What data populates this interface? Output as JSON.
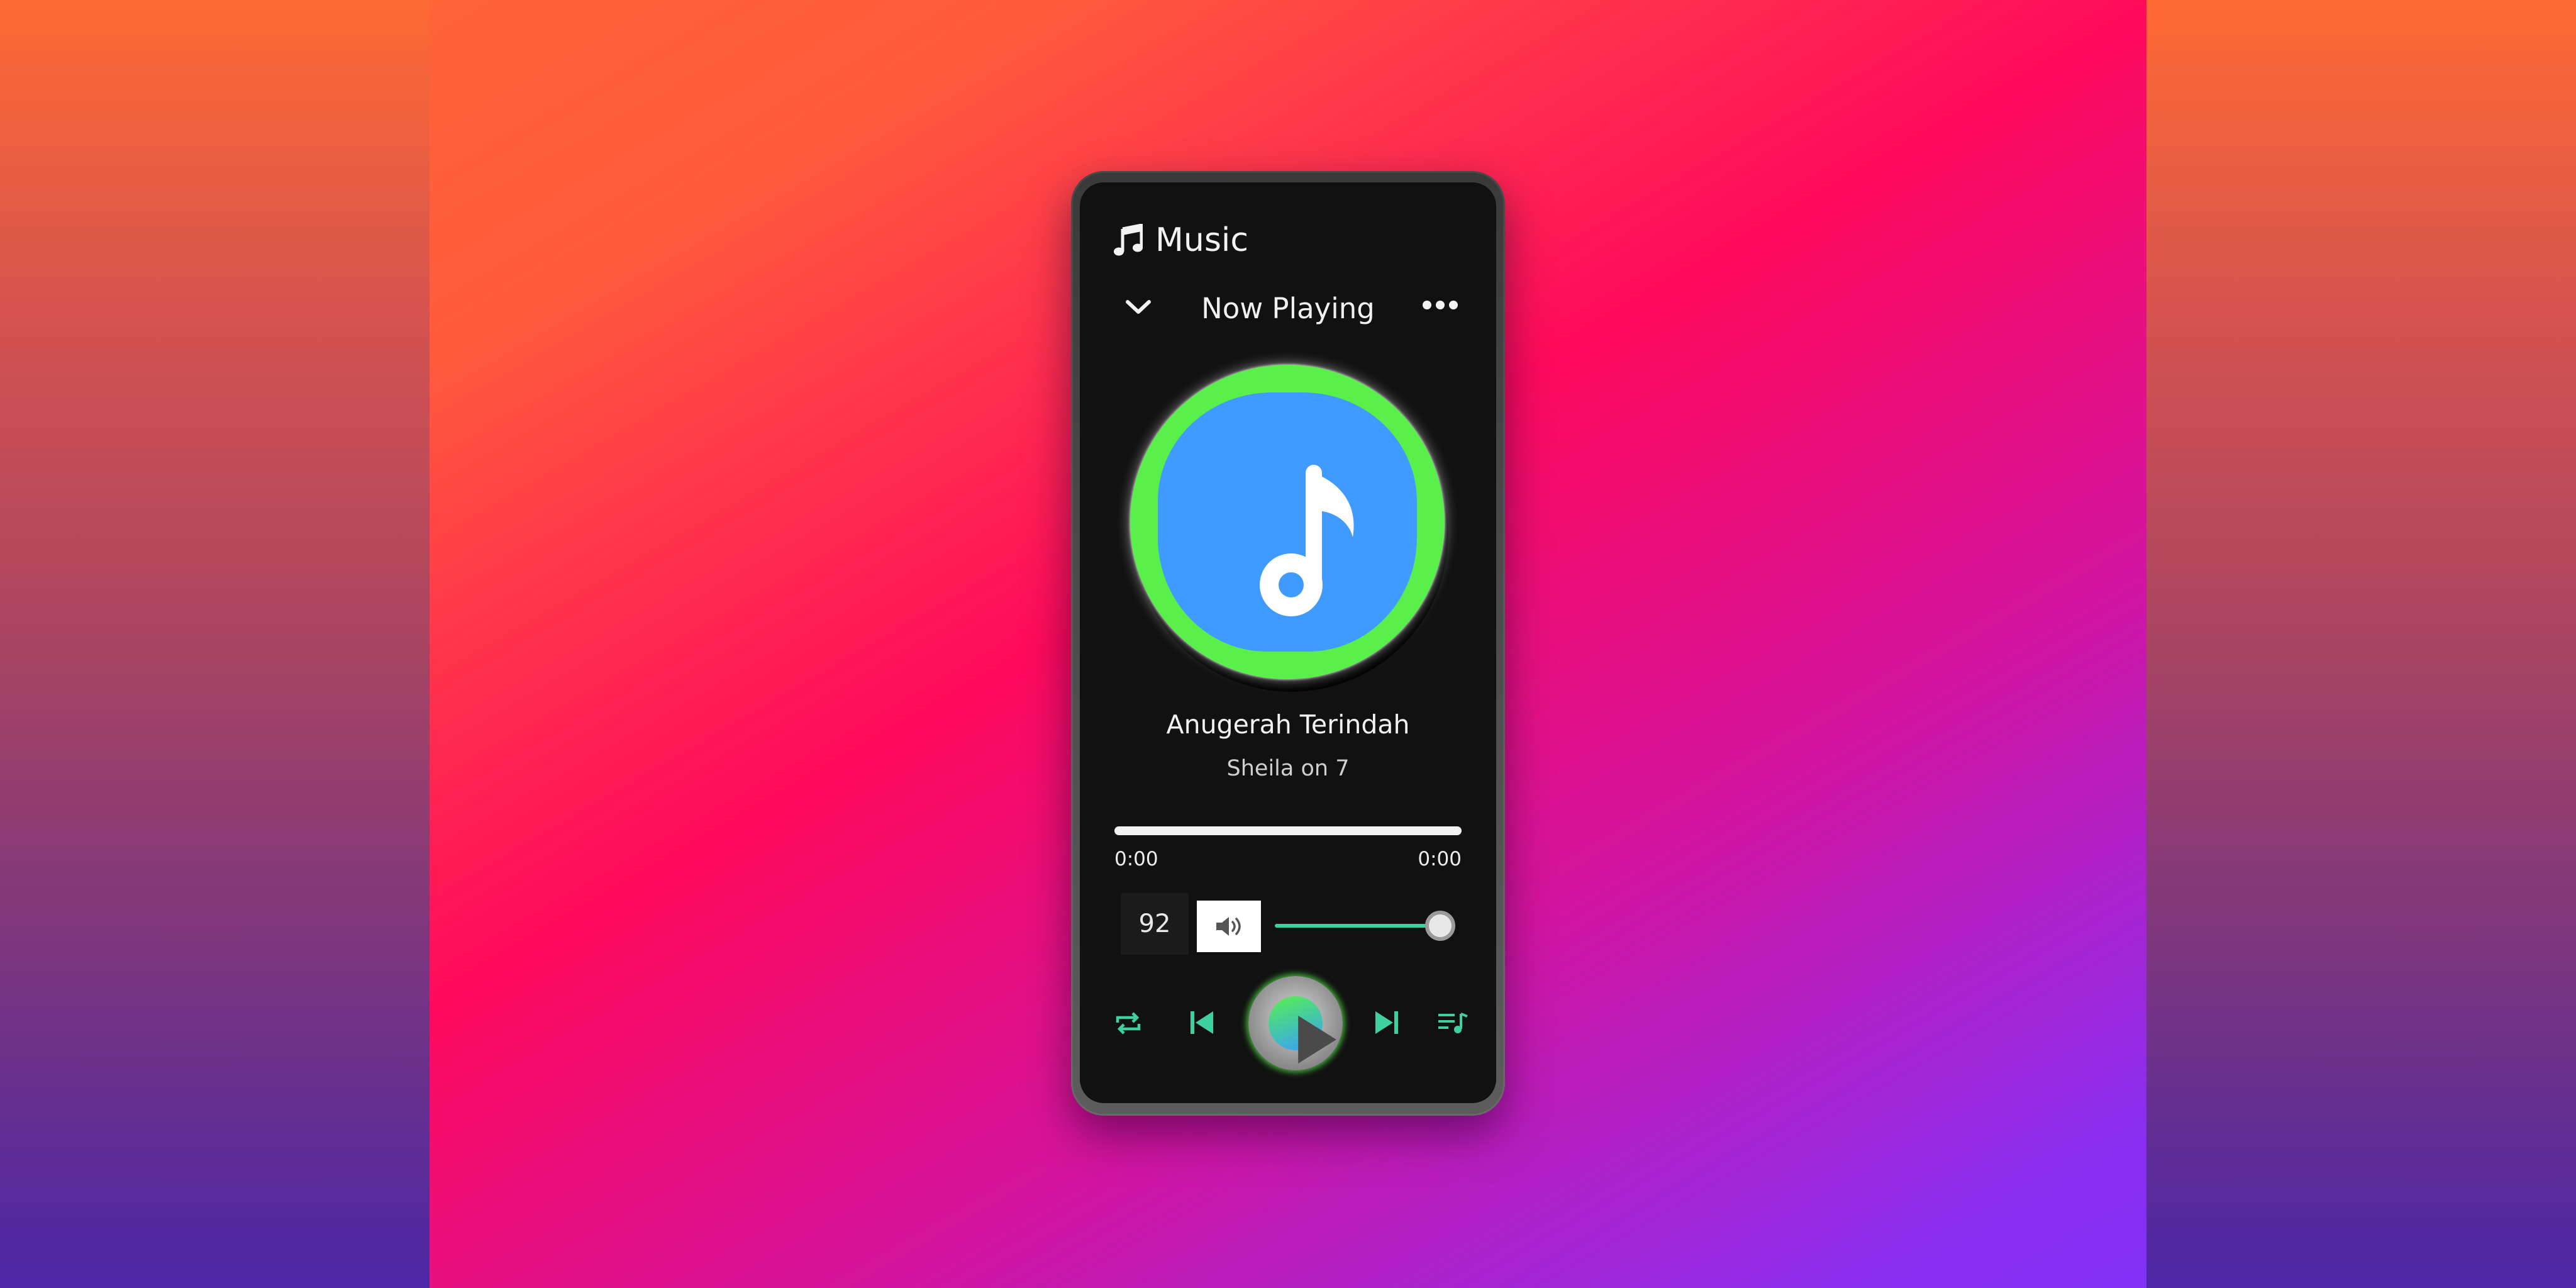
{
  "app": {
    "title": "Music"
  },
  "header": {
    "label": "Now Playing"
  },
  "track": {
    "title": "Anugerah Terindah",
    "artist": "Sheila on 7"
  },
  "progress": {
    "current": "0:00",
    "total": "0:00",
    "fraction": 0.0
  },
  "volume": {
    "value": "92",
    "level": 0.92
  },
  "colors": {
    "accent": "#3fd0a0",
    "art_ring": "#5af04b",
    "art_fill": "#3f9bff",
    "screen_bg": "#111111"
  },
  "icons": {
    "app": "music-note-icon",
    "collapse": "chevron-down-icon",
    "more": "more-horizontal-icon",
    "album_art": "music-note-icon",
    "volume": "volume-icon",
    "repeat": "repeat-icon",
    "previous": "skip-previous-icon",
    "play": "play-icon",
    "next": "skip-next-icon",
    "queue": "queue-music-icon"
  }
}
